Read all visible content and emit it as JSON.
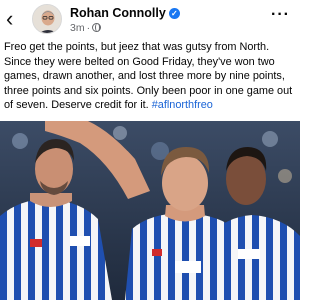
{
  "header": {
    "back_icon": "chevron-left-icon",
    "author": "Rohan Connolly",
    "verified_icon": "verified-badge-icon",
    "time": "3m",
    "separator": "·",
    "audience_icon": "globe-icon",
    "more_icon": "more-horizontal-icon",
    "more_label": "···"
  },
  "post": {
    "text": "Freo get the points, but jeez that was gutsy from North. Since they were belted on Good Friday, they've won two games, drawn another, and lost three more by nine points, three points and six points. Only been poor in one game out of seven. Deserve credit for it.",
    "hashtag": "#aflnorthfreo"
  },
  "photo": {
    "description_icon": "team-photo",
    "colors": {
      "stripe_blue": "#1f4fb0",
      "stripe_white": "#f4f5f8",
      "crowd": "#34445e"
    }
  }
}
